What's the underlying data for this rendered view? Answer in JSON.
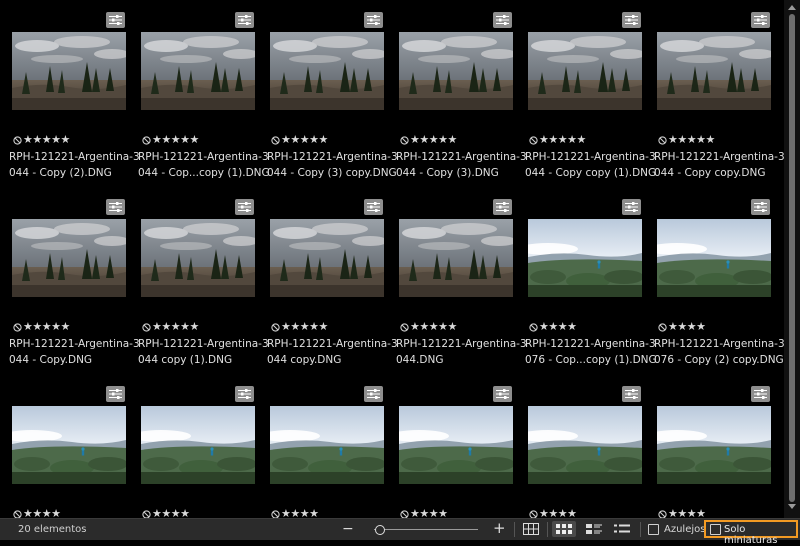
{
  "status": {
    "count_label": "20 elementos"
  },
  "footer": {
    "zoom_minus": "−",
    "zoom_plus": "+",
    "zoom_level": 0.05,
    "tiles_label": "Azulejos",
    "thumbs_only_label": "Solo miniaturas",
    "highlight_color": "#f29a23"
  },
  "rating_glyphs": "★★★★★",
  "icons": {
    "adjust": "sliders-icon",
    "reject": "reject-flag-icon",
    "grid_large": "grid-large-icon",
    "grid_medium": "grid-medium-icon",
    "details": "details-view-icon",
    "list": "list-view-icon"
  },
  "items": [
    {
      "line1": "RPH-121221-Argentina-3",
      "line2": "044 - Copy (2).DNG",
      "stars": 5,
      "scene": "rocks"
    },
    {
      "line1": "RPH-121221-Argentina-3",
      "line2": "044 - Cop...copy (1).DNG",
      "stars": 5,
      "scene": "rocks"
    },
    {
      "line1": "RPH-121221-Argentina-3",
      "line2": "044 - Copy (3) copy.DNG",
      "stars": 5,
      "scene": "rocks"
    },
    {
      "line1": "RPH-121221-Argentina-3",
      "line2": "044 - Copy (3).DNG",
      "stars": 5,
      "scene": "rocks"
    },
    {
      "line1": "RPH-121221-Argentina-3",
      "line2": "044 - Copy copy (1).DNG",
      "stars": 5,
      "scene": "rocks"
    },
    {
      "line1": "RPH-121221-Argentina-3",
      "line2": "044 - Copy copy.DNG",
      "stars": 5,
      "scene": "rocks"
    },
    {
      "line1": "RPH-121221-Argentina-3",
      "line2": "044 - Copy.DNG",
      "stars": 5,
      "scene": "rocks"
    },
    {
      "line1": "RPH-121221-Argentina-3",
      "line2": "044 copy (1).DNG",
      "stars": 5,
      "scene": "rocks"
    },
    {
      "line1": "RPH-121221-Argentina-3",
      "line2": "044 copy.DNG",
      "stars": 5,
      "scene": "rocks"
    },
    {
      "line1": "RPH-121221-Argentina-3",
      "line2": "044.DNG",
      "stars": 5,
      "scene": "rocks"
    },
    {
      "line1": "RPH-121221-Argentina-3",
      "line2": "076 - Cop...copy (1).DNG",
      "stars": 4,
      "scene": "hiker"
    },
    {
      "line1": "RPH-121221-Argentina-3",
      "line2": "076 - Copy (2) copy.DNG",
      "stars": 4,
      "scene": "hiker"
    },
    {
      "line1": "",
      "line2": "",
      "stars": 4,
      "scene": "hiker"
    },
    {
      "line1": "",
      "line2": "",
      "stars": 4,
      "scene": "hiker"
    },
    {
      "line1": "",
      "line2": "",
      "stars": 4,
      "scene": "hiker"
    },
    {
      "line1": "",
      "line2": "",
      "stars": 4,
      "scene": "hiker"
    },
    {
      "line1": "",
      "line2": "",
      "stars": 4,
      "scene": "hiker"
    },
    {
      "line1": "",
      "line2": "",
      "stars": 4,
      "scene": "hiker"
    }
  ]
}
